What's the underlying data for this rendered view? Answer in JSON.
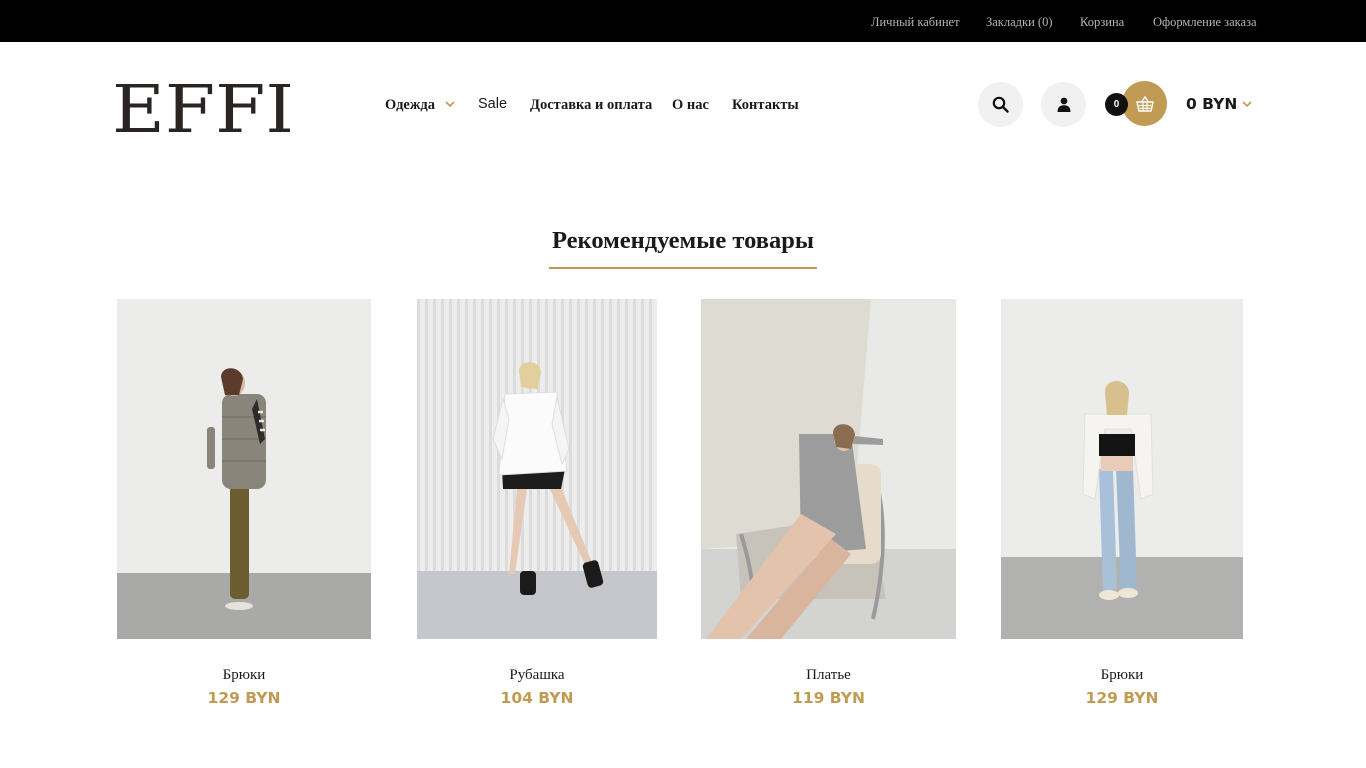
{
  "topbar": {
    "account": "Личный кабинет",
    "bookmarks": "Закладки (0)",
    "cart": "Корзина",
    "checkout": "Оформление заказа"
  },
  "brand": {
    "logo_text": "EFFI"
  },
  "nav": {
    "clothing": "Одежда",
    "sale": "Sale",
    "delivery": "Доставка и оплата",
    "about": "О нас",
    "contacts": "Контакты"
  },
  "cart": {
    "count": "0",
    "total": "0 BYN"
  },
  "icons": {
    "search": "search-icon",
    "user": "user-icon",
    "cart": "basket-icon",
    "chevron": "chevron-down-icon"
  },
  "section": {
    "title": "Рекомендуемые товары"
  },
  "products": [
    {
      "name": "Брюки",
      "price": "129 BYN"
    },
    {
      "name": "Рубашка",
      "price": "104 BYN"
    },
    {
      "name": "Платье",
      "price": "119 BYN"
    },
    {
      "name": "Брюки",
      "price": "129 BYN"
    }
  ],
  "colors": {
    "accent": "#c19b53",
    "topbar_bg": "#000000",
    "topbar_text": "#b5b5b5",
    "icon_bg": "#f1f1f1"
  }
}
